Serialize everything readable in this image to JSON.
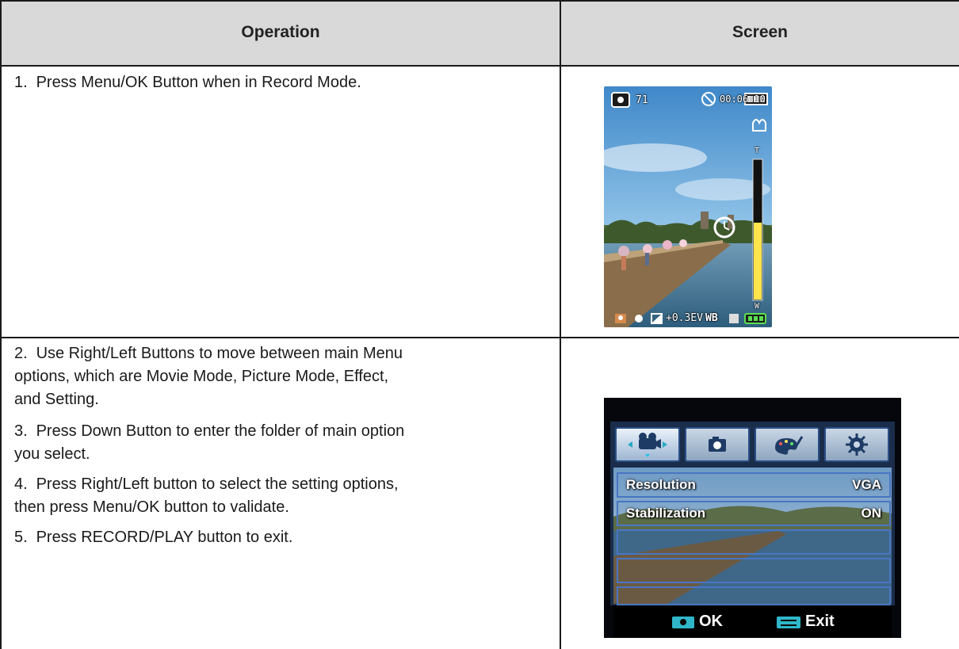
{
  "table": {
    "header_operation": "Operation",
    "header_screen": "Screen"
  },
  "rows": [
    {
      "steps": [
        {
          "num": "1.",
          "text": "Press Menu/OK Button when in Record Mode."
        }
      ],
      "screen": {
        "shots_remaining": "71",
        "recording_time": "00:06:10",
        "zoom_top": "T",
        "zoom_bottom": "W",
        "zoom_level": 0.55,
        "ev_value": "+0.3EV",
        "wb_label": "WB",
        "icons": [
          "camera-icon",
          "flash-off-icon",
          "battery-icon",
          "stabilizer-icon",
          "self-timer-icon",
          "portrait-icon",
          "macro-icon",
          "exposure-icon",
          "sd-card-icon",
          "battery-level-icon"
        ]
      }
    },
    {
      "steps": [
        {
          "num": "2.",
          "text": "Use Right/Left Buttons to move between main Menu\noptions, which are Movie Mode, Picture Mode, Effect,\nand Setting."
        },
        {
          "num": "3.",
          "text": "Press Down Button to enter the folder of main option\nyou select."
        },
        {
          "num": "4.",
          "text": "Press Right/Left button to select the setting options,\nthen press Menu/OK button to validate."
        },
        {
          "num": "5.",
          "text": "Press RECORD/PLAY button to exit."
        }
      ],
      "screen": {
        "tabs": [
          "movie-mode-icon",
          "picture-mode-icon",
          "effect-icon",
          "setting-icon"
        ],
        "menu_items": [
          {
            "label": "Resolution",
            "value": "VGA"
          },
          {
            "label": "Stabilization",
            "value": "ON"
          }
        ],
        "ok_label": "OK",
        "exit_label": "Exit"
      }
    }
  ]
}
